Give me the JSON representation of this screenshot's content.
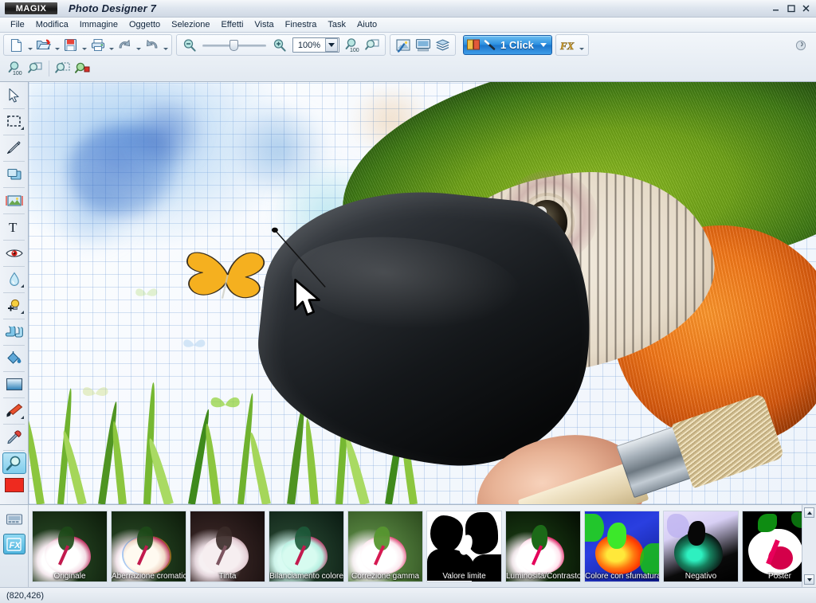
{
  "window": {
    "brand": "MAGIX",
    "title": "Photo Designer 7",
    "controls": {
      "minimize": "minimize-icon",
      "maximize": "maximize-icon",
      "close": "close-icon"
    }
  },
  "menu": {
    "items": [
      {
        "label": "File"
      },
      {
        "label": "Modifica"
      },
      {
        "label": "Immagine"
      },
      {
        "label": "Oggetto"
      },
      {
        "label": "Selezione"
      },
      {
        "label": "Effetti"
      },
      {
        "label": "Vista"
      },
      {
        "label": "Finestra"
      },
      {
        "label": "Task"
      },
      {
        "label": "Aiuto"
      }
    ]
  },
  "toolbar": {
    "file_group": [
      {
        "name": "new-document-icon",
        "has_caret": true
      },
      {
        "name": "open-folder-icon",
        "has_caret": true
      },
      {
        "name": "save-icon",
        "has_caret": true
      },
      {
        "name": "print-icon",
        "has_caret": true
      },
      {
        "name": "undo-icon",
        "has_caret": true
      },
      {
        "name": "redo-icon",
        "has_caret": true
      }
    ],
    "zoom_out_icon": "zoom-out-icon",
    "zoom_in_icon": "zoom-in-icon",
    "zoom_level": "100%",
    "zoom_100_icon": "zoom-100-icon",
    "zoom_fit_icon": "zoom-fit-icon",
    "mode_group": [
      {
        "name": "photo-edit-icon"
      },
      {
        "name": "presentation-icon"
      },
      {
        "name": "layers-icon"
      }
    ],
    "one_click": {
      "label": "1 Click",
      "icon": "magic-wand-icon",
      "caret": true
    },
    "fx_button": {
      "label": "FX",
      "has_caret": true
    },
    "help_icon": "help-icon",
    "second_row": [
      {
        "name": "zoom-100-icon"
      },
      {
        "name": "zoom-fit-icon"
      },
      {
        "name": "zoom-selection-icon"
      },
      {
        "name": "zoom-object-icon"
      }
    ]
  },
  "toolpalette": {
    "tools": [
      {
        "name": "select-arrow-tool",
        "selected": false,
        "corner": false
      },
      {
        "name": "marquee-selection-tool",
        "selected": false,
        "corner": true
      },
      {
        "name": "pen-draw-tool",
        "selected": false,
        "corner": false
      },
      {
        "name": "clone-stamp-tool",
        "selected": false,
        "corner": false
      },
      {
        "name": "crop-image-tool",
        "selected": false,
        "corner": false
      },
      {
        "name": "text-tool",
        "selected": false,
        "corner": false
      },
      {
        "name": "red-eye-tool",
        "selected": false,
        "corner": false
      },
      {
        "name": "water-drop-blur-tool",
        "selected": false,
        "corner": true
      },
      {
        "name": "brightness-lamp-tool",
        "selected": false,
        "corner": true
      },
      {
        "name": "smudge-finger-tool",
        "selected": false,
        "corner": false
      },
      {
        "name": "paint-bucket-tool",
        "selected": false,
        "corner": false
      },
      {
        "name": "gradient-tool",
        "selected": false,
        "corner": false
      },
      {
        "name": "paintbrush-tool",
        "selected": false,
        "corner": true
      },
      {
        "name": "eyedropper-tool",
        "selected": false,
        "corner": false
      },
      {
        "name": "zoom-magnifier-tool",
        "selected": true,
        "corner": false
      }
    ],
    "color_swatch": "#ee2a1f",
    "bottom_tools": [
      {
        "name": "display-preview-button",
        "selected": false
      },
      {
        "name": "fx-effects-button",
        "selected": true,
        "label": "FX"
      }
    ]
  },
  "canvas": {
    "objects": {
      "butterfly": {
        "name": "butterfly-object",
        "color": "#f5b01f",
        "selected": true
      },
      "cursor": {
        "name": "mouse-cursor"
      }
    }
  },
  "filmstrip": {
    "thumbnails": [
      {
        "label": "Originale",
        "style": "original"
      },
      {
        "label": "Aberrazione cromatica",
        "style": "chromatic"
      },
      {
        "label": "Tinta",
        "style": "tint"
      },
      {
        "label": "Bilanciamento colore",
        "style": "colorbalance"
      },
      {
        "label": "Correzione gamma",
        "style": "gamma"
      },
      {
        "label": "Valore limite",
        "style": "threshold"
      },
      {
        "label": "Luminosità/Contrasto",
        "style": "brightness"
      },
      {
        "label": "Colore con sfumatura",
        "style": "gradientmap"
      },
      {
        "label": "Negativo",
        "style": "negative"
      },
      {
        "label": "Poster",
        "style": "poster"
      }
    ],
    "scroll_up_icon": "scroll-up-icon",
    "scroll_down_icon": "scroll-down-icon"
  },
  "statusbar": {
    "coordinates": "(820,426)"
  }
}
